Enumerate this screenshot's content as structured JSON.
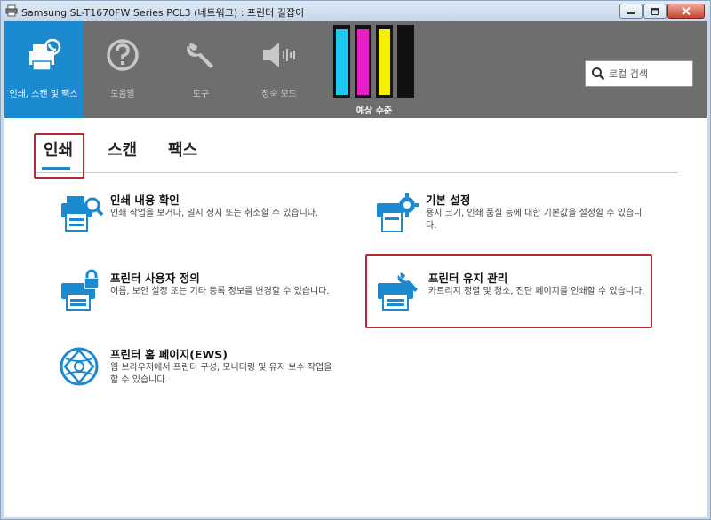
{
  "window": {
    "title": "Samsung SL-T1670FW Series PCL3 (네트워크) : 프린터 길잡이"
  },
  "toolbar": {
    "tools": [
      {
        "label": "인쇄, 스캔 및 팩스",
        "icon": "print-scan-fax-icon"
      },
      {
        "label": "도움말",
        "icon": "help-icon"
      },
      {
        "label": "도구",
        "icon": "wrench-icon"
      },
      {
        "label": "정숙 모드",
        "icon": "quiet-mode-icon"
      }
    ],
    "ink_label": "예상 수준",
    "ink_levels": [
      {
        "color": "#1ec8f0",
        "level": 0.97
      },
      {
        "color": "#e81ec8",
        "level": 0.97
      },
      {
        "color": "#f5f000",
        "level": 0.97
      },
      {
        "color": "#111111",
        "level": 0.97
      }
    ],
    "search_placeholder": "로컬 검색"
  },
  "tabs": [
    "인쇄",
    "스캔",
    "팩스"
  ],
  "items": [
    {
      "title": "인쇄 내용 확인",
      "desc": "인쇄 작업을 보거나, 일시 정지 또는 취소할 수 있습니다.",
      "icon": "print-queue-icon"
    },
    {
      "title": "기본 설정",
      "desc": "용지 크기, 인쇄 품질 등에 대한 기본값을 설정할 수 있습니다.",
      "icon": "print-settings-icon"
    },
    {
      "title": "프린터 사용자 정의",
      "desc": "이름, 보안 설정 또는 기타 등록 정보를 변경할 수 있습니다.",
      "icon": "printer-lock-icon"
    },
    {
      "title": "프린터 유지 관리",
      "desc": "카트리지 정렬 및 청소, 진단 페이지를 인쇄할 수 있습니다.",
      "icon": "printer-maintenance-icon"
    },
    {
      "title": "프린터 홈 페이지(EWS)",
      "desc": "웹 브라우저에서 프린터 구성, 모니터링 및 유지 보수 작업을 할 수 있습니다.",
      "icon": "web-globe-icon"
    }
  ],
  "colors": {
    "accent": "#1b8ad0",
    "toolbar_bg": "#6e6e6e",
    "highlight": "#b52a2f"
  }
}
